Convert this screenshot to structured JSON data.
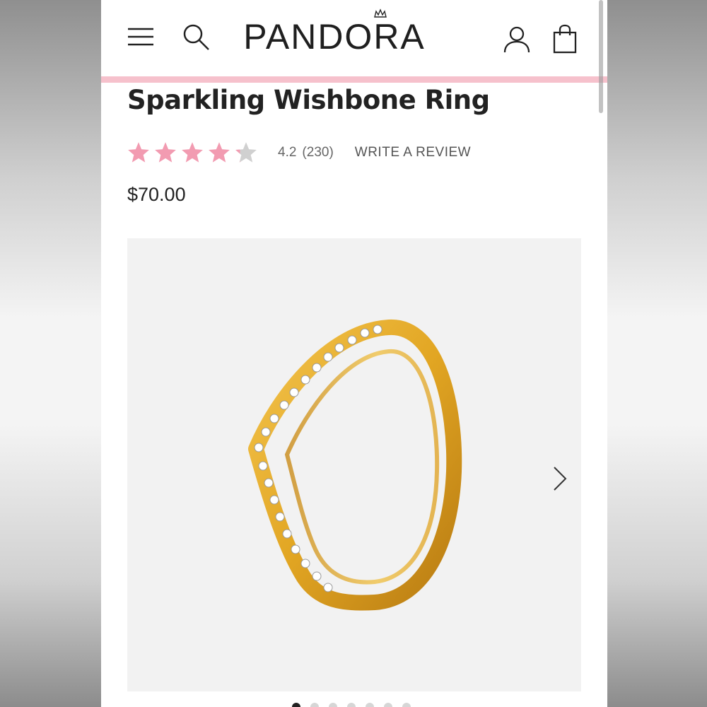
{
  "header": {
    "brand": "PANDORA",
    "menu_icon": "menu-icon",
    "search_icon": "search-icon",
    "account_icon": "account-icon",
    "bag_icon": "shopping-bag-icon"
  },
  "product": {
    "title": "Sparkling Wishbone Ring",
    "rating_value": "4.2",
    "rating_stars": 4.2,
    "review_count": "(230)",
    "write_review_label": "WRITE A REVIEW",
    "price": "$70.00",
    "image_alt_icon": "ring-image",
    "next_icon": "chevron-right-icon"
  },
  "carousel": {
    "total_slides": 7,
    "active_index": 0
  },
  "colors": {
    "accent_pink": "#f6c1cc",
    "star_pink": "#f29bb1",
    "star_grey": "#d0d0d0",
    "text_dark": "#222222"
  }
}
